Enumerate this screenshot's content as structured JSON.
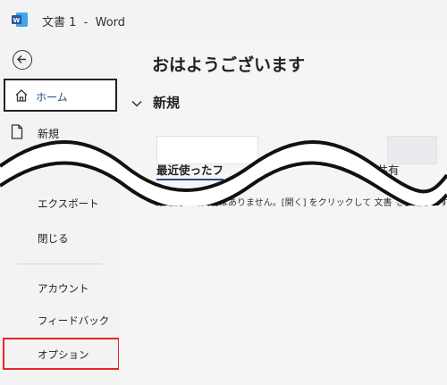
{
  "titlebar": {
    "app_icon": "word-logo-icon",
    "title": "文書 1  -  Word",
    "brand_color": "#2b579a"
  },
  "sidebar": {
    "back_icon": "back-arrow-icon",
    "items": [
      {
        "label": "ホーム",
        "icon": "home-icon",
        "selected": true
      },
      {
        "label": "新規",
        "icon": "new-document-icon"
      },
      {
        "label": "エクスポート"
      },
      {
        "label": "閉じる"
      },
      {
        "label": "アカウント"
      },
      {
        "label": "フィードバック"
      },
      {
        "label": "オプション",
        "highlighted": true
      }
    ],
    "highlight_color": "#e8262a"
  },
  "main": {
    "greeting": "おはようございます",
    "new_section": "新規",
    "tabs": {
      "recent": "最近使ったフ",
      "shared": "と共有"
    },
    "empty_message": "最近開いた文書はありません。[開く] をクリックして 文書 を参照します。"
  }
}
